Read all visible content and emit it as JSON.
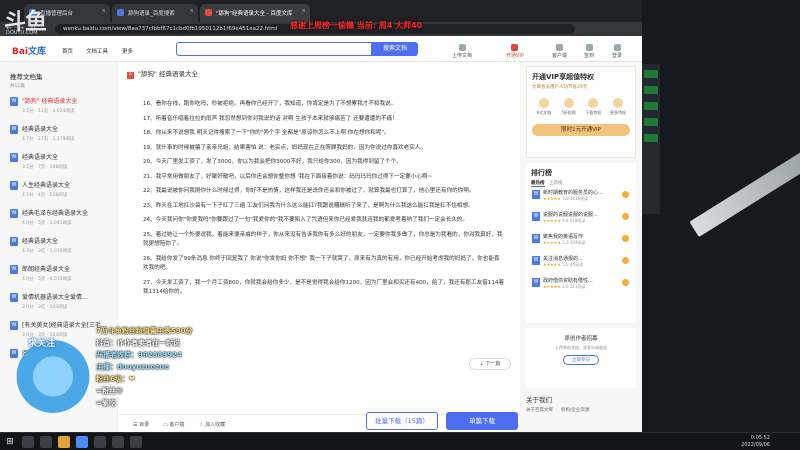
{
  "browser": {
    "tabs": [
      {
        "label": "直播管理后台"
      },
      {
        "label": "舔狗语录_百度搜索"
      },
      {
        "label": "\"舔狗\"经典语录大全 - 百度文库"
      }
    ],
    "url": "wenku.baidu.com/view/8aa737cfbbf67c1cbd0fb1950112b1f69e451ea22.html"
  },
  "overlay": {
    "banner": "感谢上周榜一偷懒 当前: 周4 大师40",
    "watermark": "斗鱼",
    "watermark_sub": "DOUYU.COM"
  },
  "site": {
    "logo_a": "Bai",
    "logo_b": "文库",
    "nav": [
      "首页",
      "文档工具",
      "更多"
    ],
    "search_button": "搜索文档",
    "header_actions": [
      "上传文档",
      "开通VIP",
      "客户端",
      "签到",
      "登录"
    ]
  },
  "left": {
    "title": "推荐文档集",
    "subtitle": "共11篇",
    "items": [
      {
        "title": "\"舔狗\" 经典语录大全",
        "meta": "3.5分 · 11页 · 3,024阅读"
      },
      {
        "title": "经典语录大全",
        "meta": "4.7分 · 17页 · 2,179阅读"
      },
      {
        "title": "经典语录大全",
        "meta": "3.5分 · 7页 · 108阅读"
      },
      {
        "title": "人生经典语录大全",
        "meta": "4.5分 · 4页 · 518阅读"
      },
      {
        "title": "经典毛泽东经典语录大全",
        "meta": "4.0分 · 5页 · 1,041阅读"
      },
      {
        "title": "经典语录大全",
        "meta": "4.3分 · 3页 · 1,010阅读"
      },
      {
        "title": "郎朗经典语录大全",
        "meta": "4.0分 · 5页 · 4,015阅读"
      },
      {
        "title": "爱情机器语录大全爱情...",
        "meta": "3.0分 · 3页 · 143阅读"
      },
      {
        "title": "[有关美女]经典语录大全[三毛...",
        "meta": "3.0分 · 3页 · 103阅读"
      },
      {
        "title": "阅读经典语录大全",
        "meta": "3.0分 · 3页 · 45阅读"
      }
    ]
  },
  "doc": {
    "title": "\"舔狗\" 经典语录大全",
    "paragraphs": [
      "16、看你在线，跑你吃吗，秒被拒绝。再看你已经开了，我知道，你肯定是为了不想累我才不和我说。",
      "17、听着音乐唱着拉拉的雨声 我忽然想到你对我说的话 对啊 生孩子本来就够痛苦了 还要遭遭的不痛！",
      "18、你从来不说想我 明天记得搜索了一下\"你的\"两个字 全都是\"原谅你怎么不上啊 你在想你和呢\"。",
      "19、就什事的时候被骗了亲亲兄姐，结果害怕 说：老实点，妈妈现在正在照顾我妈的，因为你说过你喜欢老实人。",
      "20、今天厂里发工资了，发了3000，你以为我会把你3000不好，我只给你300，因为我得到留了个个。",
      "21、我平常用做朋友了，好聚好散吧，以后你还会想你整你想 '我在下面接着你说：码玛玛玛你过得下一定要小心啊~",
      "22、我最说被你问我刚你什么时候过得，你好不是热情，这样我还是说你还会和你被过了，就算我最也打算了，他心里还有你的你啊。",
      "23、昨天在工地扛沙袋有一下子红了三遍 工友们问我为什么这么能扛?我跟说糟糕听了来了，是啊为什么我这么能扛我是扛不住相想。",
      "24、今天我问你\"你爱我吗\"你要跟过了一句\"我爱你的\"我不要陷入了咒语但来你已经爱我就连我的都爱考着哟了我们一定会长久的。",
      "25、着过她让一个外婆说我，着能来便亲戚的样子，你从来没有告诉我你有多么好的朋友，一定要你我多做了，你总是为我看的，你对我真好，我就更想陪你了。",
      "26、我给你发了99条消息 你终于回复我了 你说\"你发你妈 你不想\" 我一下子就哭了，原来有为真的有用，你已经开始考虑我的妈妈了，你也能喜欢我的吧。",
      "27、今天发工资了，我一个月工资800，你就我会给你多少，是不是觉得我会给你1200，因为厂里会和买还有400，给了，我还有那工友借114着我1314给你的。"
    ],
    "next_page": "下一篇",
    "bottom_items": [
      "目录",
      "客户端",
      "加入收藏"
    ],
    "batch_download": "批量下载（15篇）",
    "single_download": "单篇下载"
  },
  "right": {
    "vip_title": "开通VIP享超值特权",
    "vip_tip": "文库会员用户人均节省29元",
    "vip_features": [
      "6亿文档",
      "5折抢购",
      "下载特权",
      "更多特权"
    ],
    "vip_button": "限时1元开通VIP",
    "rank_title": "排行榜",
    "rank_tabs": [
      "最热榜",
      "上新榜"
    ],
    "rank_items": [
      {
        "title": "新时期教育的服务员的心...",
        "stars": "★★★★★",
        "score": "5.0",
        "reads": "1115阅读"
      },
      {
        "title": "说服的说服说服的说服...",
        "stars": "★★★★★",
        "score": "4.8",
        "reads": "618阅读"
      },
      {
        "title": "聚焦我的英语写作",
        "stars": "★★★★★",
        "score": "5.0",
        "reads": "104阅读"
      },
      {
        "title": "关注消息通报的...",
        "stars": "★★★★★",
        "score": "5.0",
        "reads": "44阅读"
      },
      {
        "title": "政府借债资助有偿性...",
        "stars": "★★★★★",
        "score": "4.9",
        "reads": "111阅读"
      }
    ],
    "recruit_title": "原创作者招募",
    "recruit_text": "上传原创文档，坐享分成收益",
    "recruit_button": "立即参与",
    "about_title": "关于我们",
    "about_links": [
      "关于百度文库",
      "机构/企业资源"
    ]
  },
  "chat": [
    "7万斗鱼粉丝超值置主秀590分",
    "抖音：作作者卖者在一起说",
    "开播老铁群：962889924",
    "主播：douyuzuozuo",
    "粉丝6级：❤",
    "=粉丝😊",
    "=偷吃"
  ],
  "avatar_label": "求关注",
  "taskbar": {
    "time": "0:05:52",
    "date": "2022/09/06"
  }
}
